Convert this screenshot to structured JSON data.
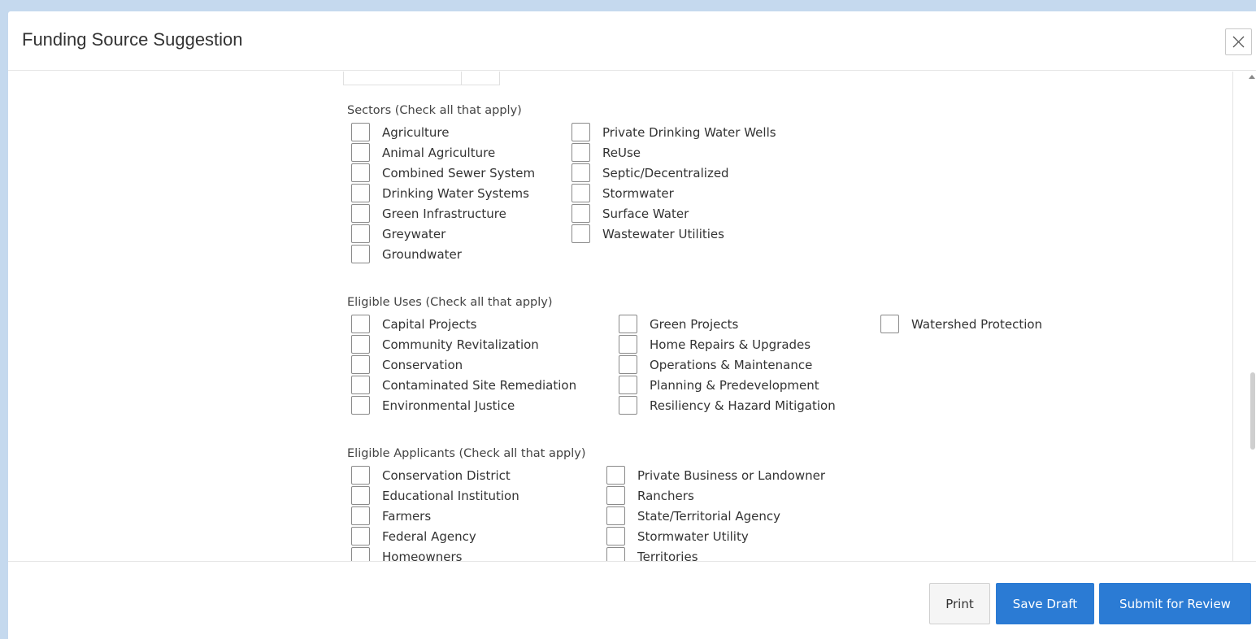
{
  "modal": {
    "title": "Funding Source Suggestion",
    "close_icon": "close-icon"
  },
  "sectors": {
    "title": "Sectors (Check all that apply)",
    "col1": [
      "Agriculture",
      "Animal Agriculture",
      "Combined Sewer System",
      "Drinking Water Systems",
      "Green Infrastructure",
      "Greywater",
      "Groundwater"
    ],
    "col2": [
      "Private Drinking Water Wells",
      "ReUse",
      "Septic/Decentralized",
      "Stormwater",
      "Surface Water",
      "Wastewater Utilities"
    ]
  },
  "uses": {
    "title": "Eligible Uses (Check all that apply)",
    "col1": [
      "Capital Projects",
      "Community Revitalization",
      "Conservation",
      "Contaminated Site Remediation",
      "Environmental Justice"
    ],
    "col2": [
      "Green Projects",
      "Home Repairs & Upgrades",
      "Operations & Maintenance",
      "Planning & Predevelopment",
      "Resiliency & Hazard Mitigation"
    ],
    "col3": [
      "Watershed Protection"
    ]
  },
  "applicants": {
    "title": "Eligible Applicants (Check all that apply)",
    "col1": [
      "Conservation District",
      "Educational Institution",
      "Farmers",
      "Federal Agency",
      "Homeowners"
    ],
    "col2": [
      "Private Business or Landowner",
      "Ranchers",
      "State/Territorial Agency",
      "Stormwater Utility",
      "Territories"
    ]
  },
  "footer": {
    "print_label": "Print",
    "save_draft_label": "Save Draft",
    "submit_label": "Submit for Review"
  }
}
